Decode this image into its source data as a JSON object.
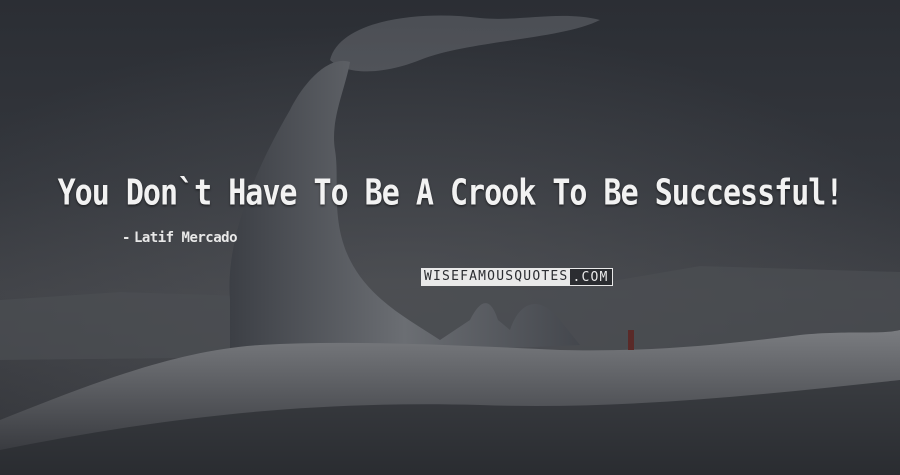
{
  "quote": {
    "text": "You Don`t Have To Be A Crook To Be Successful!"
  },
  "author": {
    "dash": "-",
    "name": "Latif Mercado"
  },
  "watermark": {
    "left": "WISEFAMOUSQUOTES",
    "right": ".COM"
  },
  "colors": {
    "text": "#f2f2f2",
    "background": "#2f3136"
  }
}
